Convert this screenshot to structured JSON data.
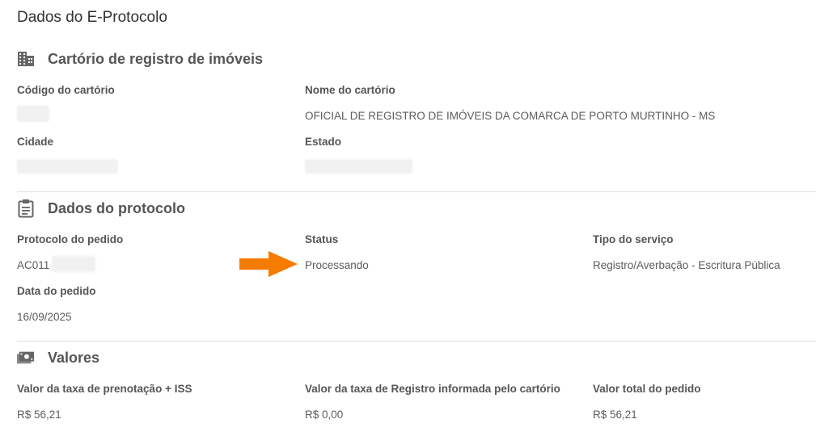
{
  "page": {
    "title": "Dados do E-Protocolo"
  },
  "cartorio": {
    "section_title": "Cartório de registro de imóveis",
    "icon": "building-icon",
    "codigo_label": "Código do cartório",
    "nome_label": "Nome do cartório",
    "nome_value": "OFICIAL DE REGISTRO DE IMÓVEIS DA COMARCA DE PORTO MURTINHO - MS",
    "cidade_label": "Cidade",
    "estado_label": "Estado"
  },
  "protocolo": {
    "section_title": "Dados do protocolo",
    "icon": "clipboard-icon",
    "protocolo_label": "Protocolo do pedido",
    "protocolo_value": "AC011",
    "status_label": "Status",
    "status_value": "Processando",
    "tipo_label": "Tipo do serviço",
    "tipo_value": "Registro/Averbação - Escritura Pública",
    "data_label": "Data do pedido",
    "data_value": "16/09/2025"
  },
  "valores": {
    "section_title": "Valores",
    "icon": "money-icon",
    "prenotacao_label": "Valor da taxa de prenotação + ISS",
    "prenotacao_value": "R$ 56,21",
    "registro_label": "Valor da taxa de Registro informada pelo cartório",
    "registro_value": "R$ 0,00",
    "total_label": "Valor total do pedido",
    "total_value": "R$ 56,21"
  },
  "annotation": {
    "arrow_color": "#f57c00",
    "icon": "arrow-right-icon"
  }
}
